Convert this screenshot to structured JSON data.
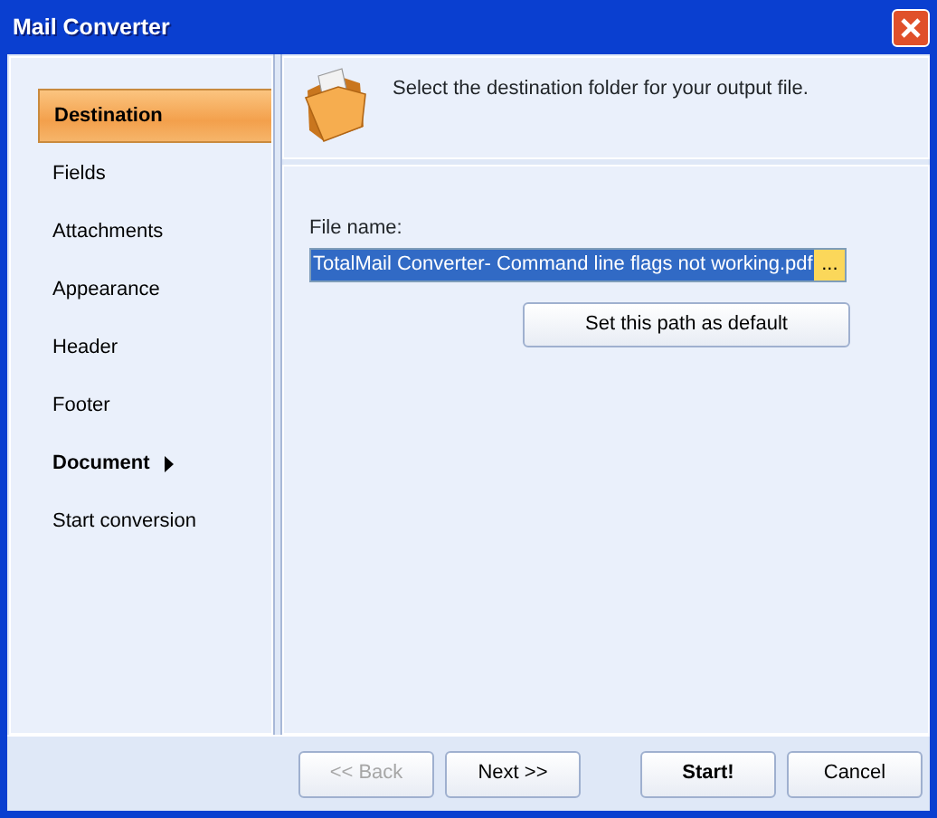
{
  "window": {
    "title": "Mail Converter"
  },
  "sidebar": {
    "items": [
      {
        "label": "Destination",
        "selected": true,
        "has_submenu": false
      },
      {
        "label": "Fields",
        "selected": false,
        "has_submenu": false
      },
      {
        "label": "Attachments",
        "selected": false,
        "has_submenu": false
      },
      {
        "label": "Appearance",
        "selected": false,
        "has_submenu": false
      },
      {
        "label": "Header",
        "selected": false,
        "has_submenu": false
      },
      {
        "label": "Footer",
        "selected": false,
        "has_submenu": false
      },
      {
        "label": "Document",
        "selected": false,
        "has_submenu": true
      },
      {
        "label": "Start conversion",
        "selected": false,
        "has_submenu": false
      }
    ]
  },
  "header": {
    "text": "Select the destination folder for your output file."
  },
  "file_name": {
    "label": "File name:",
    "value": "TotalMail Converter- Command line flags not working.pdf",
    "browse": "...",
    "value_selected": true
  },
  "default_button": "Set this path as default",
  "buttons": [
    {
      "label": "<< Back",
      "disabled": true,
      "bold": false
    },
    {
      "label": "Next >>",
      "disabled": false,
      "bold": false
    },
    {
      "label": "Start!",
      "disabled": false,
      "bold": true
    },
    {
      "label": "Cancel",
      "disabled": false,
      "bold": false
    }
  ]
}
